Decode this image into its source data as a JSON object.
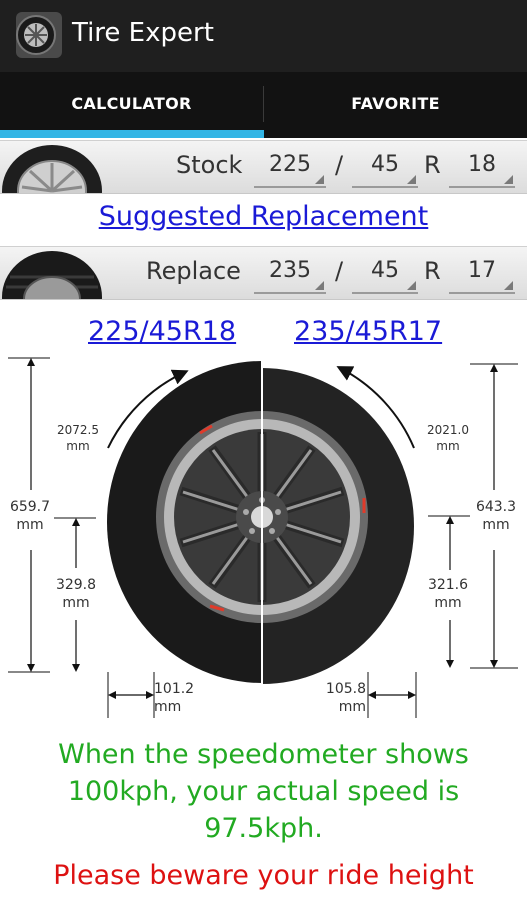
{
  "app": {
    "title": "Tire Expert"
  },
  "tabs": [
    {
      "label": "CALCULATOR",
      "selected": true
    },
    {
      "label": "FAVORITE",
      "selected": false
    }
  ],
  "stock": {
    "label": "Stock",
    "width": "225",
    "sep": "/",
    "aspect": "45",
    "r": "R",
    "rim": "18"
  },
  "replace": {
    "label": "Replace",
    "width": "235",
    "sep": "/",
    "aspect": "45",
    "r": "R",
    "rim": "17"
  },
  "suggested_link": "Suggested Replacement",
  "diagram": {
    "stock_size": "225/45R18",
    "replace_size": "235/45R17",
    "stock_circumference": "2072.5",
    "replace_circumference": "2021.0",
    "stock_diameter": "659.7",
    "replace_diameter": "643.3",
    "stock_radius": "329.8",
    "replace_radius": "321.6",
    "stock_sidewall": "101.2",
    "replace_sidewall": "105.8",
    "unit": "mm"
  },
  "result": {
    "speed_message": "When the speedometer shows 100kph, your actual speed is 97.5kph.",
    "warning": "Please beware your ride height"
  },
  "colors": {
    "accent": "#33b5e5",
    "link": "#1a1ad6",
    "ok": "#22aa22",
    "warn": "#dd1111"
  }
}
